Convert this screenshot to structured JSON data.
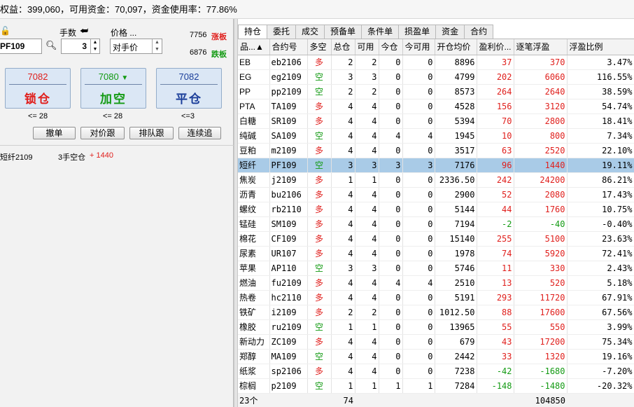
{
  "topbar": {
    "text": "权益：399,060，可用资金：70,097，资金使用率：77.86%"
  },
  "order": {
    "lots_label": "手数",
    "price_label": "价格 ...",
    "contract_value": "PF109",
    "lots_value": "3",
    "price_value": "对手价",
    "limit_up": "7756",
    "limit_up_label": "涨板",
    "limit_down": "6876",
    "limit_down_label": "跌板"
  },
  "actions": [
    {
      "price": "7082",
      "label": "锁仓",
      "limit": "<= 28"
    },
    {
      "price": "7080",
      "label": "加空",
      "limit": "<= 28"
    },
    {
      "price": "7082",
      "label": "平仓",
      "limit": "<=3"
    }
  ],
  "small_buttons": [
    "撤单",
    "对价跟",
    "排队跟",
    "连续追"
  ],
  "position_info": {
    "contract": "短纤2109",
    "desc": "3手空仓",
    "pnl": "+ 1440"
  },
  "tabs": [
    "持仓",
    "委托",
    "成交",
    "预备单",
    "条件单",
    "损盈单",
    "资金",
    "合约"
  ],
  "columns": [
    "品...▲",
    "合约号",
    "多空",
    "总仓",
    "可用",
    "今仓",
    "今可用",
    "开仓均价",
    "盈利价...",
    "逐笔浮盈",
    "浮盈比例"
  ],
  "rows": [
    [
      "EB",
      "eb2106",
      "多",
      "2",
      "2",
      "0",
      "0",
      "8896",
      "37",
      "370",
      "3.47%"
    ],
    [
      "EG",
      "eg2109",
      "空",
      "3",
      "3",
      "0",
      "0",
      "4799",
      "202",
      "6060",
      "116.55%"
    ],
    [
      "PP",
      "pp2109",
      "空",
      "2",
      "2",
      "0",
      "0",
      "8573",
      "264",
      "2640",
      "38.59%"
    ],
    [
      "PTA",
      "TA109",
      "多",
      "4",
      "4",
      "0",
      "0",
      "4528",
      "156",
      "3120",
      "54.74%"
    ],
    [
      "白糖",
      "SR109",
      "多",
      "4",
      "4",
      "0",
      "0",
      "5394",
      "70",
      "2800",
      "18.41%"
    ],
    [
      "纯碱",
      "SA109",
      "空",
      "4",
      "4",
      "4",
      "4",
      "1945",
      "10",
      "800",
      "7.34%"
    ],
    [
      "豆粕",
      "m2109",
      "多",
      "4",
      "4",
      "0",
      "0",
      "3517",
      "63",
      "2520",
      "22.10%"
    ],
    [
      "短纤",
      "PF109",
      "空",
      "3",
      "3",
      "3",
      "3",
      "7176",
      "96",
      "1440",
      "19.11%"
    ],
    [
      "焦炭",
      "j2109",
      "多",
      "1",
      "1",
      "0",
      "0",
      "2336.50",
      "242",
      "24200",
      "86.21%"
    ],
    [
      "沥青",
      "bu2106",
      "多",
      "4",
      "4",
      "0",
      "0",
      "2900",
      "52",
      "2080",
      "17.43%"
    ],
    [
      "螺纹",
      "rb2110",
      "多",
      "4",
      "4",
      "0",
      "0",
      "5144",
      "44",
      "1760",
      "10.75%"
    ],
    [
      "锰硅",
      "SM109",
      "多",
      "4",
      "4",
      "0",
      "0",
      "7194",
      "-2",
      "-40",
      "-0.40%"
    ],
    [
      "棉花",
      "CF109",
      "多",
      "4",
      "4",
      "0",
      "0",
      "15140",
      "255",
      "5100",
      "23.63%"
    ],
    [
      "尿素",
      "UR107",
      "多",
      "4",
      "4",
      "0",
      "0",
      "1978",
      "74",
      "5920",
      "72.41%"
    ],
    [
      "苹果",
      "AP110",
      "空",
      "3",
      "3",
      "0",
      "0",
      "5746",
      "11",
      "330",
      "2.43%"
    ],
    [
      "燃油",
      "fu2109",
      "多",
      "4",
      "4",
      "4",
      "4",
      "2510",
      "13",
      "520",
      "5.18%"
    ],
    [
      "热卷",
      "hc2110",
      "多",
      "4",
      "4",
      "0",
      "0",
      "5191",
      "293",
      "11720",
      "67.91%"
    ],
    [
      "铁矿",
      "i2109",
      "多",
      "2",
      "2",
      "0",
      "0",
      "1012.50",
      "88",
      "17600",
      "67.56%"
    ],
    [
      "橡胶",
      "ru2109",
      "空",
      "1",
      "1",
      "0",
      "0",
      "13965",
      "55",
      "550",
      "3.99%"
    ],
    [
      "新动力",
      "ZC109",
      "多",
      "4",
      "4",
      "0",
      "0",
      "679",
      "43",
      "17200",
      "75.34%"
    ],
    [
      "郑醇",
      "MA109",
      "空",
      "4",
      "4",
      "0",
      "0",
      "2442",
      "33",
      "1320",
      "19.16%"
    ],
    [
      "纸浆",
      "sp2106",
      "多",
      "4",
      "4",
      "0",
      "0",
      "7238",
      "-42",
      "-1680",
      "-7.20%"
    ],
    [
      "棕榈",
      "p2109",
      "空",
      "1",
      "1",
      "1",
      "1",
      "7284",
      "-148",
      "-1480",
      "-20.32%"
    ]
  ],
  "summary": {
    "count": "23个",
    "total": "74",
    "float_total": "104850"
  },
  "selected_row": 7,
  "colors": {
    "long": "#e0201d",
    "short": "#139a13",
    "selected": "#a9cbe7"
  }
}
